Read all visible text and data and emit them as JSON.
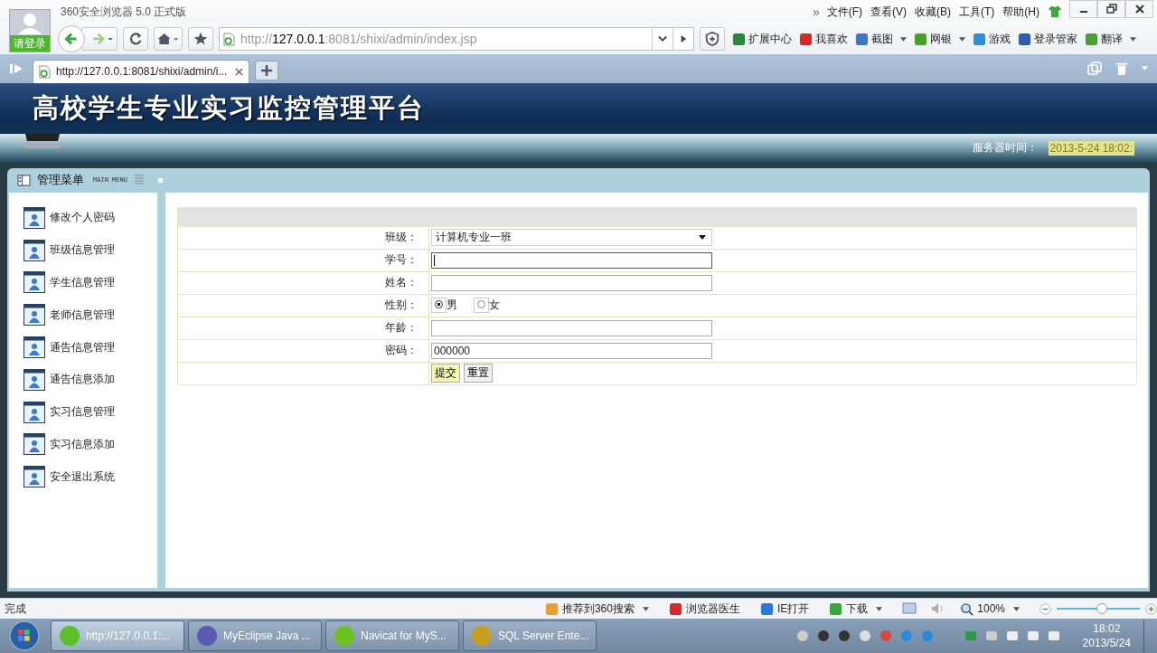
{
  "browser": {
    "title": "360安全浏览器 5.0 正式版",
    "account_label": "请登录",
    "overflow_mark": "»",
    "menu": [
      "文件(F)",
      "查看(V)",
      "收藏(B)",
      "工具(T)",
      "帮助(H)"
    ],
    "address": {
      "scheme": "http://",
      "host": "127.0.0.1",
      "path": ":8081/shixi/admin/index.jsp"
    },
    "toolbar": [
      {
        "label": "扩展中心",
        "has_menu": false
      },
      {
        "label": "我喜欢",
        "has_menu": false
      },
      {
        "label": "截图",
        "has_menu": true
      },
      {
        "label": "网银",
        "has_menu": true
      },
      {
        "label": "游戏",
        "has_menu": false
      },
      {
        "label": "登录管家",
        "has_menu": false
      },
      {
        "label": "翻译",
        "has_menu": true
      }
    ],
    "tabs": [
      {
        "label": "http://127.0.0.1:8081/shixi/admin/i...",
        "selected": true
      }
    ]
  },
  "page": {
    "title": "高校学生专业实习监控管理平台",
    "server_time_label": "服务器时间：",
    "server_time": "2013-5-24 18:02:",
    "menu_title": "管理菜单",
    "menu_subtitle": "MAIN MENU",
    "sidebar": {
      "items": [
        "修改个人密码",
        "班级信息管理",
        "学生信息管理",
        "老师信息管理",
        "通告信息管理",
        "通告信息添加",
        "实习信息管理",
        "实习信息添加",
        "安全退出系统"
      ]
    },
    "form": {
      "fields": [
        {
          "label": "班级：",
          "kind": "select",
          "value": "计算机专业一班"
        },
        {
          "label": "学号：",
          "kind": "text",
          "focused": true
        },
        {
          "label": "姓名：",
          "kind": "text",
          "focused": false
        },
        {
          "label": "性别：",
          "kind": "radio",
          "options": [
            {
              "label": "男",
              "selected": true
            },
            {
              "label": "女",
              "selected": false
            }
          ]
        },
        {
          "label": "年龄：",
          "kind": "text",
          "focused": false
        },
        {
          "label": "密码：",
          "kind": "text",
          "value": "000000",
          "focused": false
        }
      ],
      "buttons": [
        {
          "label": "提交",
          "highlighted": true
        },
        {
          "label": "重置",
          "highlighted": false
        }
      ]
    }
  },
  "status_bar": {
    "text": "完成",
    "items": [
      {
        "label": "推荐到360搜索",
        "has_menu": true
      },
      {
        "label": "浏览器医生",
        "has_menu": false
      },
      {
        "label": "IE打开",
        "has_menu": false
      },
      {
        "label": "下载",
        "has_menu": true
      }
    ],
    "zoom": "100%",
    "zoom_level": {
      "level": 0.55
    }
  },
  "taskbar": {
    "apps": [
      {
        "label": "http://127.0.0.1:...",
        "selected": true
      },
      {
        "label": "MyEclipse Java ...",
        "selected": false
      },
      {
        "label": "Navicat for MyS...",
        "selected": false
      },
      {
        "label": "SQL Server Ente...",
        "selected": false
      }
    ],
    "time": "18:02",
    "date": "2013/5/24"
  }
}
